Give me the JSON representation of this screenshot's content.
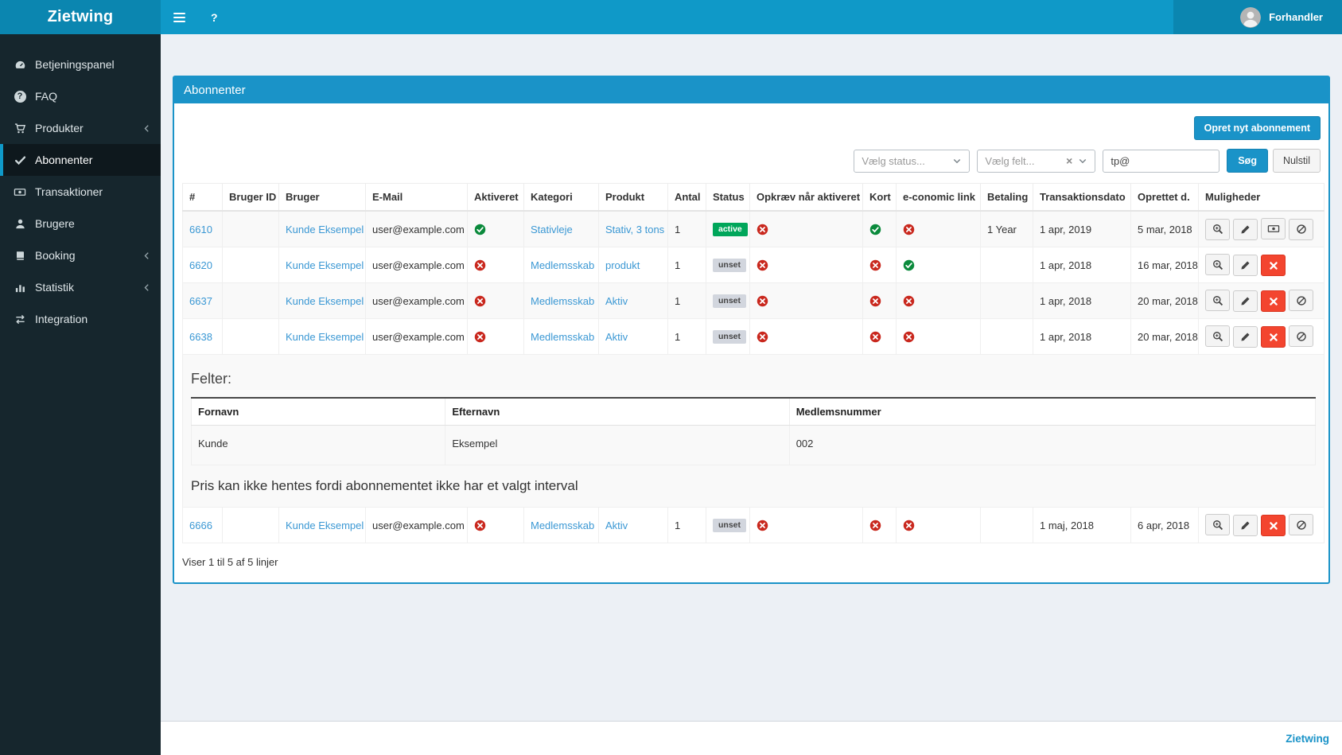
{
  "app": {
    "brand": "Zietwing",
    "footer_brand": "Zietwing"
  },
  "navbar": {
    "menu_icon": "hamburger-icon",
    "help_label": "?",
    "user": {
      "name": "Forhandler",
      "avatar_icon": "user-avatar-icon"
    }
  },
  "sidebar": {
    "items": [
      {
        "label": "Betjeningspanel",
        "icon": "dashboard-icon",
        "active": false,
        "has_submenu": false
      },
      {
        "label": "FAQ",
        "icon": "question-circle-icon",
        "active": false,
        "has_submenu": false
      },
      {
        "label": "Produkter",
        "icon": "cart-icon",
        "active": false,
        "has_submenu": true
      },
      {
        "label": "Abonnenter",
        "icon": "check-icon",
        "active": true,
        "has_submenu": false
      },
      {
        "label": "Transaktioner",
        "icon": "banknote-icon",
        "active": false,
        "has_submenu": false
      },
      {
        "label": "Brugere",
        "icon": "user-icon",
        "active": false,
        "has_submenu": false
      },
      {
        "label": "Booking",
        "icon": "book-icon",
        "active": false,
        "has_submenu": true
      },
      {
        "label": "Statistik",
        "icon": "bar-chart-icon",
        "active": false,
        "has_submenu": true
      },
      {
        "label": "Integration",
        "icon": "exchange-icon",
        "active": false,
        "has_submenu": false
      }
    ]
  },
  "panel": {
    "title": "Abonnenter",
    "create_button": "Opret nyt abonnement",
    "filters": {
      "status_placeholder": "Vælg status...",
      "field_placeholder": "Vælg felt...",
      "clear_icon": "clear-x-icon",
      "dropdown_icon": "chevron-down-icon",
      "search_value": "tp@",
      "search_button": "Søg",
      "reset_button": "Nulstil"
    },
    "table": {
      "columns": [
        "#",
        "Bruger ID",
        "Bruger",
        "E-Mail",
        "Aktiveret",
        "Kategori",
        "Produkt",
        "Antal",
        "Status",
        "Opkræv når aktiveret",
        "Kort",
        "e-conomic link",
        "Betaling",
        "Transaktionsdato",
        "Oprettet d.",
        "Muligheder"
      ],
      "rows": [
        {
          "id": "6610",
          "bruger_id": "",
          "bruger": "Kunde Eksempel",
          "email": "user@example.com",
          "aktiveret": true,
          "kategori": "Stativleje",
          "produkt": "Stativ, 3 tons",
          "antal": "1",
          "status": "active",
          "opkraev": false,
          "kort": true,
          "economic": false,
          "betaling": "1 Year",
          "transaktionsdato": "1 apr, 2019",
          "oprettet": "5 mar, 2018",
          "actions": [
            "zoom",
            "edit",
            "money",
            "ban"
          ]
        },
        {
          "id": "6620",
          "bruger_id": "",
          "bruger": "Kunde Eksempel",
          "email": "user@example.com",
          "aktiveret": false,
          "kategori": "Medlemsskab",
          "produkt": "produkt",
          "antal": "1",
          "status": "unset",
          "opkraev": false,
          "kort": false,
          "economic": true,
          "betaling": "",
          "transaktionsdato": "1 apr, 2018",
          "oprettet": "16 mar, 2018",
          "actions": [
            "zoom",
            "edit",
            "delete"
          ]
        },
        {
          "id": "6637",
          "bruger_id": "",
          "bruger": "Kunde Eksempel",
          "email": "user@example.com",
          "aktiveret": false,
          "kategori": "Medlemsskab",
          "produkt": "Aktiv",
          "antal": "1",
          "status": "unset",
          "opkraev": false,
          "kort": false,
          "economic": false,
          "betaling": "",
          "transaktionsdato": "1 apr, 2018",
          "oprettet": "20 mar, 2018",
          "actions": [
            "zoom",
            "edit",
            "delete",
            "ban"
          ]
        },
        {
          "id": "6638",
          "bruger_id": "",
          "bruger": "Kunde Eksempel",
          "email": "user@example.com",
          "aktiveret": false,
          "kategori": "Medlemsskab",
          "produkt": "Aktiv",
          "antal": "1",
          "status": "unset",
          "opkraev": false,
          "kort": false,
          "economic": false,
          "betaling": "",
          "transaktionsdato": "1 apr, 2018",
          "oprettet": "20 mar, 2018",
          "actions": [
            "zoom",
            "edit",
            "delete",
            "ban"
          ]
        },
        {
          "id": "6666",
          "bruger_id": "",
          "bruger": "Kunde Eksempel",
          "email": "user@example.com",
          "aktiveret": false,
          "kategori": "Medlemsskab",
          "produkt": "Aktiv",
          "antal": "1",
          "status": "unset",
          "opkraev": false,
          "kort": false,
          "economic": false,
          "betaling": "",
          "transaktionsdato": "1 maj, 2018",
          "oprettet": "6 apr, 2018",
          "actions": [
            "zoom",
            "edit",
            "delete",
            "ban"
          ]
        }
      ],
      "detail": {
        "title": "Felter:",
        "fields": {
          "columns": [
            "Fornavn",
            "Efternavn",
            "Medlemsnummer"
          ],
          "values": [
            "Kunde",
            "Eksempel",
            "002"
          ]
        },
        "message": "Pris kan ikke hentes fordi abonnementet ikke har et valgt interval"
      },
      "footer": "Viser 1 til 5 af 5 linjer",
      "bool_icons": {
        "true": "check-circle-icon",
        "false": "x-circle-icon"
      },
      "action_icons": {
        "zoom": "magnifier-plus-icon",
        "edit": "pencil-icon",
        "money": "banknote-icon",
        "ban": "ban-icon",
        "delete": "x-icon"
      }
    }
  },
  "colors": {
    "navbar": "#0f99c8",
    "navbar_dark": "#0b86b0",
    "sidebar": "#16262d",
    "panel_accent": "#1a93c8",
    "link": "#3b98d4",
    "success_badge": "#00a65a",
    "unset_badge": "#d2d6de",
    "check_icon": "#0b8a3c",
    "x_icon": "#c9281e",
    "delete_button": "#f3452f",
    "content_bg": "#ecf0f5"
  }
}
